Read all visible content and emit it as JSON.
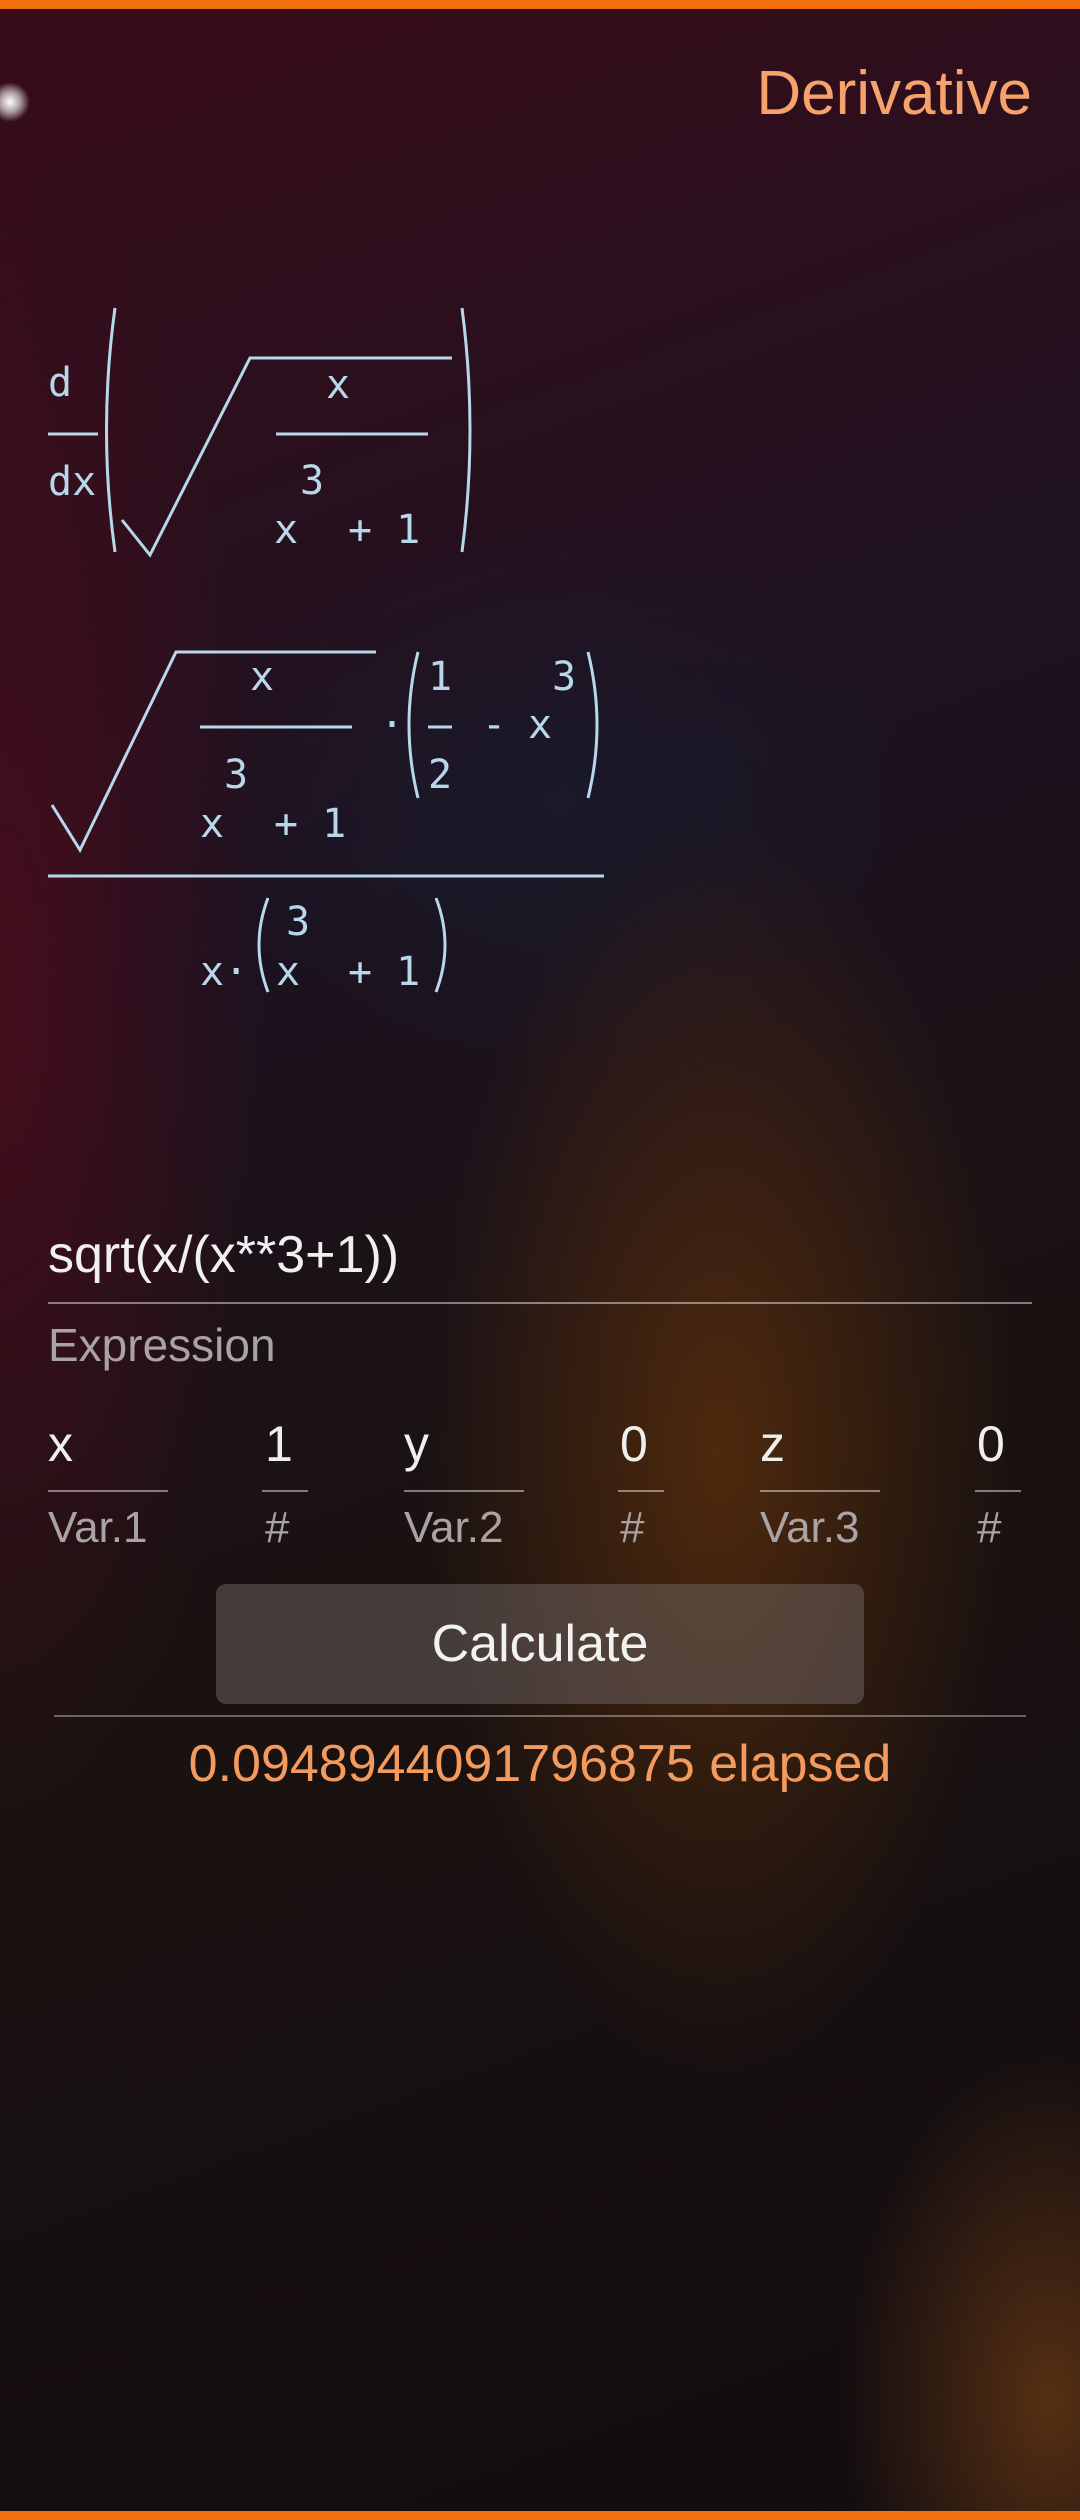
{
  "header": {
    "title": "Derivative"
  },
  "rendered_math": {
    "derivative": {
      "d_top": "d",
      "d_bottom": "dx",
      "numerator": "x",
      "denominator_exp": "3",
      "denominator_base": "x",
      "denominator_rest": "+ 1"
    },
    "result": {
      "frac_num": "x",
      "frac_den_exp": "3",
      "frac_den_base": "x",
      "frac_den_rest": "+ 1",
      "dot": "·",
      "half_num": "1",
      "half_den": "2",
      "minus": "-",
      "x_cube_exp": "3",
      "x_cube_base": "x",
      "bottom_x": "x·",
      "bottom_exp": "3",
      "bottom_base": "x",
      "bottom_rest": "+ 1"
    }
  },
  "expression": {
    "value": "sqrt(x/(x**3+1))",
    "label": "Expression"
  },
  "variables": [
    {
      "name": "x",
      "value": "1",
      "name_label": "Var.1",
      "value_label": "#"
    },
    {
      "name": "y",
      "value": "0",
      "name_label": "Var.2",
      "value_label": "#"
    },
    {
      "name": "z",
      "value": "0",
      "name_label": "Var.3",
      "value_label": "#"
    }
  ],
  "actions": {
    "calculate_label": "Calculate"
  },
  "status": {
    "elapsed_text": "0.0948944091796875 elapsed"
  },
  "colors": {
    "accent": "#f2700d",
    "title": "#f6a36b",
    "math": "#b7d8ea",
    "elapsed": "#f39a5e"
  }
}
